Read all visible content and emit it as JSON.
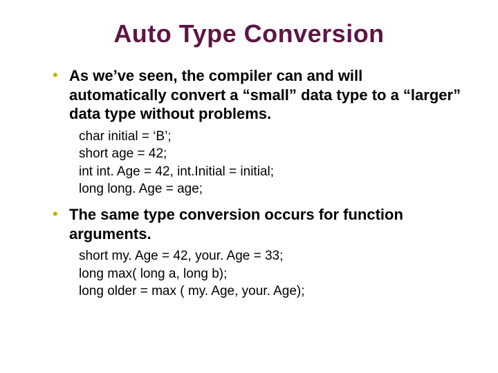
{
  "title": "Auto Type Conversion",
  "bullets": [
    {
      "lead": "As we’ve seen, the compiler can and will automatically convert a “small” data type to a “larger” data type without problems.",
      "code": [
        "char initial = ‘B’;",
        "short age = 42;",
        "int int. Age = 42, int.Initial = initial;",
        "long long. Age = age;"
      ]
    },
    {
      "lead": "The same type conversion occurs for function arguments.",
      "code": [
        "short my. Age = 42, your. Age = 33;",
        "long max( long a, long b);",
        "long older = max ( my. Age, your. Age);"
      ]
    }
  ]
}
